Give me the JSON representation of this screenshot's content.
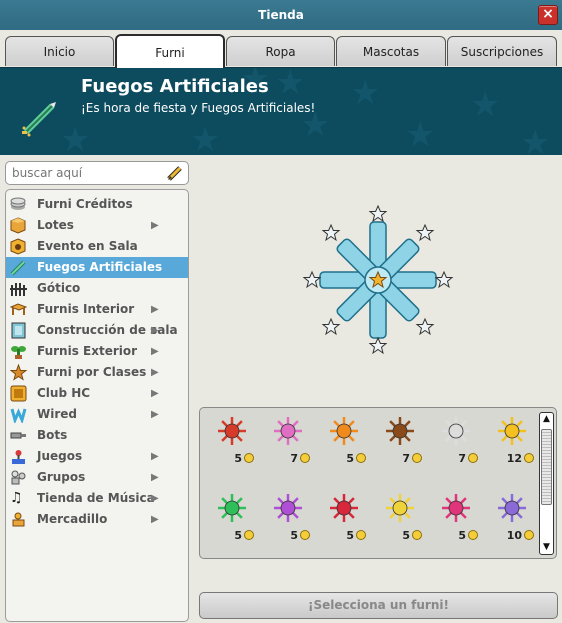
{
  "window": {
    "title": "Tienda",
    "close_icon": "close-icon"
  },
  "tabs": [
    {
      "label": "Inicio",
      "active": false
    },
    {
      "label": "Furni",
      "active": true
    },
    {
      "label": "Ropa",
      "active": false
    },
    {
      "label": "Mascotas",
      "active": false
    },
    {
      "label": "Suscripciones",
      "active": false
    }
  ],
  "banner": {
    "title": "Fuegos Artificiales",
    "subtitle": "¡Es hora de fiesta y Fuegos Artificiales!",
    "icon": "firework-rocket-icon",
    "background_color": "#0d4b5e"
  },
  "search": {
    "placeholder": "buscar aquí",
    "value": "",
    "icon": "pencil-icon"
  },
  "categories": [
    {
      "label": "Furni Créditos",
      "icon": "credits-icon",
      "has_submenu": false,
      "active": false
    },
    {
      "label": "Lotes",
      "icon": "box-icon",
      "has_submenu": true,
      "active": false
    },
    {
      "label": "Evento en Sala",
      "icon": "event-box-icon",
      "has_submenu": false,
      "active": false
    },
    {
      "label": "Fuegos Artificiales",
      "icon": "rocket-icon",
      "has_submenu": false,
      "active": true
    },
    {
      "label": "Gótico",
      "icon": "gothic-fence-icon",
      "has_submenu": false,
      "active": false
    },
    {
      "label": "Furnis Interior",
      "icon": "table-icon",
      "has_submenu": true,
      "active": false
    },
    {
      "label": "Construcción de sala",
      "icon": "wall-icon",
      "has_submenu": true,
      "active": false
    },
    {
      "label": "Furnis Exterior",
      "icon": "plant-icon",
      "has_submenu": true,
      "active": false
    },
    {
      "label": "Furni por Clases",
      "icon": "star-icon",
      "has_submenu": true,
      "active": false
    },
    {
      "label": "Club HC",
      "icon": "hc-icon",
      "has_submenu": true,
      "active": false
    },
    {
      "label": "Wired",
      "icon": "wired-icon",
      "has_submenu": true,
      "active": false
    },
    {
      "label": "Bots",
      "icon": "bot-icon",
      "has_submenu": false,
      "active": false
    },
    {
      "label": "Juegos",
      "icon": "joystick-icon",
      "has_submenu": true,
      "active": false
    },
    {
      "label": "Grupos",
      "icon": "group-icon",
      "has_submenu": true,
      "active": false
    },
    {
      "label": "Tienda de Música",
      "icon": "music-note-icon",
      "has_submenu": true,
      "active": false
    },
    {
      "label": "Mercadillo",
      "icon": "market-icon",
      "has_submenu": true,
      "active": false
    }
  ],
  "preview": {
    "icon": "snowflake-firework-preview-icon"
  },
  "items": [
    {
      "price": "5",
      "icon": "red-firework-icon",
      "color": "#d63a2a"
    },
    {
      "price": "7",
      "icon": "pink-sparkle-firework-icon",
      "color": "#e06fc4"
    },
    {
      "price": "5",
      "icon": "flame-firework-icon",
      "color": "#f08a1c"
    },
    {
      "price": "7",
      "icon": "firework-crate-icon",
      "color": "#8a4a1a"
    },
    {
      "price": "7",
      "icon": "white-firework-icon",
      "color": "#dddddd"
    },
    {
      "price": "12",
      "icon": "gold-burst-firework-icon",
      "color": "#f3c020"
    },
    {
      "price": "5",
      "icon": "green-firework-icon",
      "color": "#2fbf5a"
    },
    {
      "price": "5",
      "icon": "purple-firework-icon",
      "color": "#b04fd6"
    },
    {
      "price": "5",
      "icon": "red-burst-firework-icon",
      "color": "#d8263a"
    },
    {
      "price": "5",
      "icon": "yellow-firework-icon",
      "color": "#f0d23a"
    },
    {
      "price": "5",
      "icon": "magenta-star-firework-icon",
      "color": "#e0357a"
    },
    {
      "price": "10",
      "icon": "purple-fountain-firework-icon",
      "color": "#8a6ad8"
    }
  ],
  "currency_icon": "coin-icon",
  "select_button": {
    "label": "¡Selecciona un furni!"
  }
}
